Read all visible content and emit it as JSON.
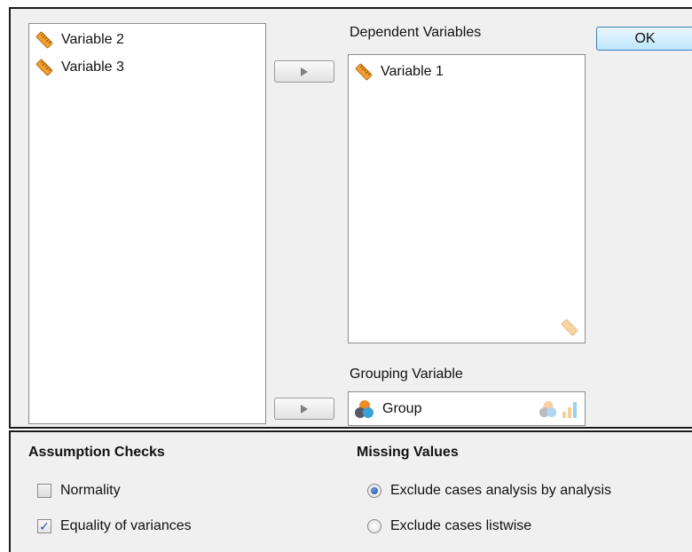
{
  "source_list": {
    "items": [
      {
        "label": "Variable 2",
        "icon": "scale-ruler-icon"
      },
      {
        "label": "Variable 3",
        "icon": "scale-ruler-icon"
      }
    ]
  },
  "dependent": {
    "caption": "Dependent Variables",
    "items": [
      {
        "label": "Variable 1",
        "icon": "scale-ruler-icon"
      }
    ]
  },
  "grouping": {
    "caption": "Grouping Variable",
    "value": "Group",
    "icon": "nominal-circles-icon"
  },
  "ok_button": {
    "label": "OK"
  },
  "assumption_checks": {
    "title": "Assumption Checks",
    "options": [
      {
        "label": "Normality",
        "checked": false
      },
      {
        "label": "Equality of variances",
        "checked": true
      }
    ]
  },
  "missing_values": {
    "title": "Missing Values",
    "options": [
      {
        "label": "Exclude cases analysis by analysis",
        "selected": true
      },
      {
        "label": "Exclude cases listwise",
        "selected": false
      }
    ]
  },
  "colors": {
    "panel_bg": "#f0f0f0",
    "ruler_orange": "#e8901e",
    "ok_blue": "#bee6fd",
    "radio_blue": "#1e4c9a"
  }
}
